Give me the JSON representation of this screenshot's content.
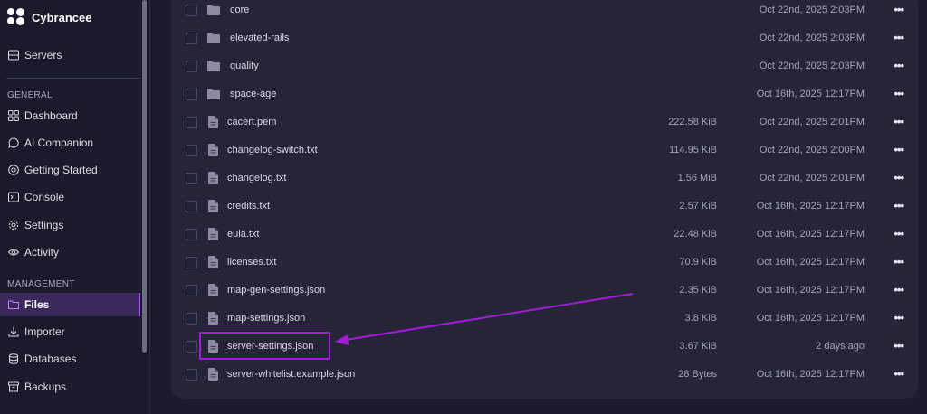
{
  "app": {
    "name": "Cybrancee"
  },
  "sidebar": {
    "servers_label": "Servers",
    "general_label": "GENERAL",
    "management_label": "MANAGEMENT",
    "general_items": [
      {
        "label": "Dashboard",
        "icon": "dashboard-icon"
      },
      {
        "label": "AI Companion",
        "icon": "chat-icon"
      },
      {
        "label": "Getting Started",
        "icon": "help-icon"
      },
      {
        "label": "Console",
        "icon": "terminal-icon"
      },
      {
        "label": "Settings",
        "icon": "gear-icon"
      },
      {
        "label": "Activity",
        "icon": "eye-icon"
      }
    ],
    "management_items": [
      {
        "label": "Files",
        "icon": "folder-icon",
        "active": true
      },
      {
        "label": "Importer",
        "icon": "download-icon"
      },
      {
        "label": "Databases",
        "icon": "database-icon"
      },
      {
        "label": "Backups",
        "icon": "archive-icon"
      }
    ]
  },
  "files": [
    {
      "name": "core",
      "type": "folder",
      "size": "",
      "modified": "Oct 22nd, 2025 2:03PM"
    },
    {
      "name": "elevated-rails",
      "type": "folder",
      "size": "",
      "modified": "Oct 22nd, 2025 2:03PM"
    },
    {
      "name": "quality",
      "type": "folder",
      "size": "",
      "modified": "Oct 22nd, 2025 2:03PM"
    },
    {
      "name": "space-age",
      "type": "folder",
      "size": "",
      "modified": "Oct 16th, 2025 12:17PM"
    },
    {
      "name": "cacert.pem",
      "type": "file",
      "size": "222.58 KiB",
      "modified": "Oct 22nd, 2025 2:01PM"
    },
    {
      "name": "changelog-switch.txt",
      "type": "file",
      "size": "114.95 KiB",
      "modified": "Oct 22nd, 2025 2:00PM"
    },
    {
      "name": "changelog.txt",
      "type": "file",
      "size": "1.56 MiB",
      "modified": "Oct 22nd, 2025 2:01PM"
    },
    {
      "name": "credits.txt",
      "type": "file",
      "size": "2.57 KiB",
      "modified": "Oct 16th, 2025 12:17PM"
    },
    {
      "name": "eula.txt",
      "type": "file",
      "size": "22.48 KiB",
      "modified": "Oct 16th, 2025 12:17PM"
    },
    {
      "name": "licenses.txt",
      "type": "file",
      "size": "70.9 KiB",
      "modified": "Oct 16th, 2025 12:17PM"
    },
    {
      "name": "map-gen-settings.json",
      "type": "file",
      "size": "2.35 KiB",
      "modified": "Oct 16th, 2025 12:17PM"
    },
    {
      "name": "map-settings.json",
      "type": "file",
      "size": "3.8 KiB",
      "modified": "Oct 16th, 2025 12:17PM"
    },
    {
      "name": "server-settings.json",
      "type": "file",
      "size": "3.67 KiB",
      "modified": "2 days ago"
    },
    {
      "name": "server-whitelist.example.json",
      "type": "file",
      "size": "28 Bytes",
      "modified": "Oct 16th, 2025 12:17PM"
    }
  ],
  "row_menu_label": "•••",
  "colors": {
    "accent": "#a64dff",
    "highlight": "#a21bd6",
    "panel": "#252438",
    "background": "#1c1b2e"
  }
}
